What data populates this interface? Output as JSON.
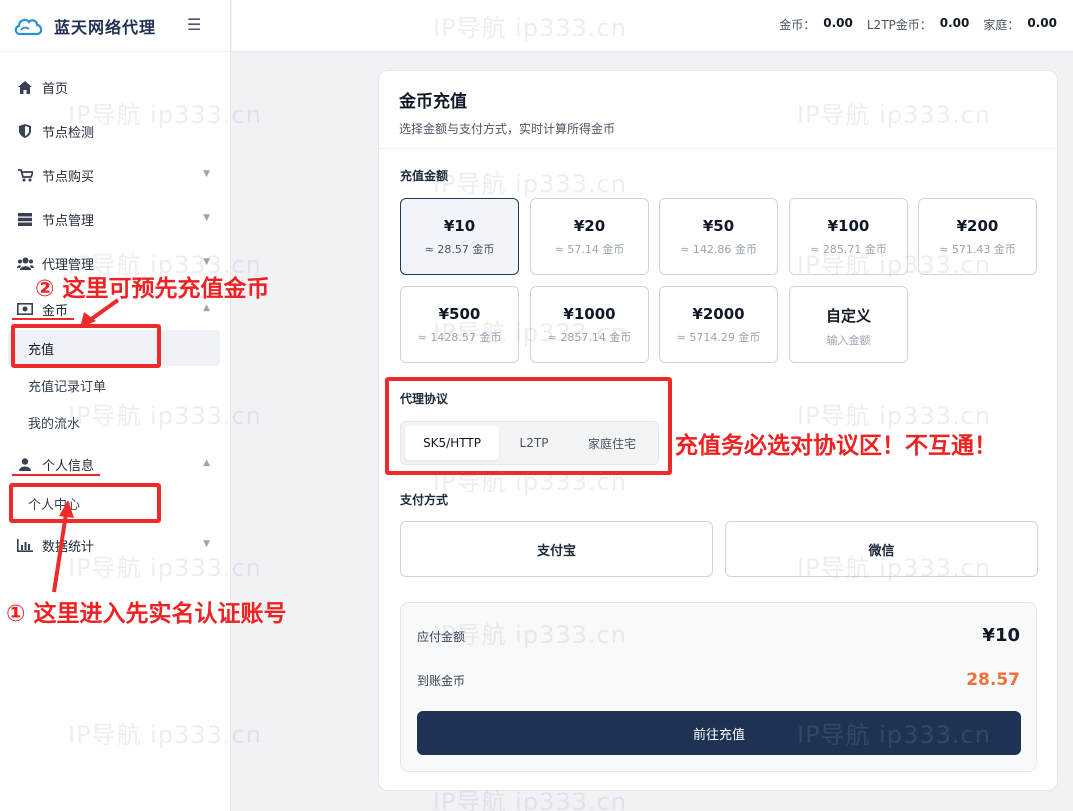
{
  "app": {
    "brand": "蓝天网络代理"
  },
  "header": {
    "balances": [
      {
        "label": "金币：",
        "value": "0.00"
      },
      {
        "label": "L2TP金币：",
        "value": "0.00"
      },
      {
        "label": "家庭：",
        "value": "0.00"
      }
    ]
  },
  "sidebar": {
    "items": [
      {
        "label": "首页"
      },
      {
        "label": "节点检测"
      },
      {
        "label": "节点购买"
      },
      {
        "label": "节点管理"
      },
      {
        "label": "代理管理"
      },
      {
        "label": "金币"
      },
      {
        "label": "个人信息"
      },
      {
        "label": "数据统计"
      }
    ],
    "gold_sub": [
      {
        "label": "充值"
      },
      {
        "label": "充值记录订单"
      },
      {
        "label": "我的流水"
      }
    ],
    "profile_sub": [
      {
        "label": "个人中心"
      }
    ]
  },
  "recharge": {
    "title": "金币充值",
    "subtitle": "选择金额与支付方式，实时计算所得金币",
    "amount_label": "充值金额",
    "amounts": [
      {
        "price": "¥10",
        "coins": "≈ 28.57 金币"
      },
      {
        "price": "¥20",
        "coins": "≈ 57.14 金币"
      },
      {
        "price": "¥50",
        "coins": "≈ 142.86 金币"
      },
      {
        "price": "¥100",
        "coins": "≈ 285.71 金币"
      },
      {
        "price": "¥200",
        "coins": "≈ 571.43 金币"
      },
      {
        "price": "¥500",
        "coins": "≈ 1428.57 金币"
      },
      {
        "price": "¥1000",
        "coins": "≈ 2857.14 金币"
      },
      {
        "price": "¥2000",
        "coins": "≈ 5714.29 金币"
      },
      {
        "price": "自定义",
        "coins": "输入金额"
      }
    ],
    "selected_amount": "¥10",
    "protocol_label": "代理协议",
    "protocols": [
      {
        "label": "SK5/HTTP"
      },
      {
        "label": "L2TP"
      },
      {
        "label": "家庭住宅"
      }
    ],
    "selected_protocol": "SK5/HTTP",
    "payment_label": "支付方式",
    "payments": [
      {
        "label": "支付宝"
      },
      {
        "label": "微信"
      }
    ],
    "summary": {
      "payable_label": "应付金额",
      "payable_value": "¥10",
      "coins_label": "到账金币",
      "coins_value": "28.57",
      "submit_label": "前往充值"
    }
  },
  "annotations": {
    "note_recharge": "② 这里可预先充值金币",
    "note_protocol": "充值务必选对协议区！不互通！",
    "note_profile": "① 这里进入先实名认证账号",
    "color": "#ee2b2b"
  },
  "watermark": "IP导航 ip333.cn",
  "colors": {
    "primary": "#1e3354",
    "accent_orange": "#f26f3a",
    "annotation_red": "#ee2b2b"
  }
}
